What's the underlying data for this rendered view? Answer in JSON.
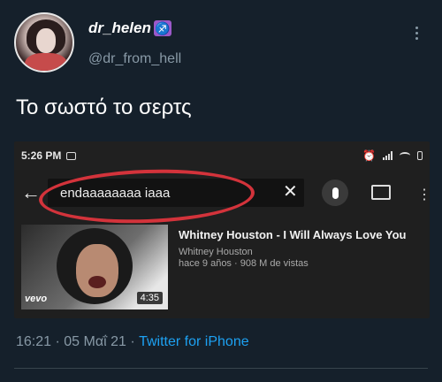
{
  "author": {
    "display_name": "dr_helen",
    "badge_icon": "sagittarius-emoji",
    "badge_glyph": "♐",
    "handle": "@dr_from_hell"
  },
  "tweet": {
    "text": "Το σωστό το σερτς",
    "time": "16:21",
    "separator": " · ",
    "date": "05 Μαΐ 21",
    "client": "Twitter for iPhone"
  },
  "screenshot": {
    "status_time": "5:26 PM",
    "search_value": "endaaaaaaaa iaaa",
    "result": {
      "title": "Whitney Houston - I Will Always Love You",
      "channel": "Whitney Houston",
      "stats": "hace 9 años · 908 M de vistas",
      "duration": "4:35",
      "thumb_logo": "vevo"
    }
  },
  "colors": {
    "background": "#15202b",
    "link": "#1da1f2",
    "muted": "#8899a6",
    "highlight_ring": "#d3333b"
  }
}
